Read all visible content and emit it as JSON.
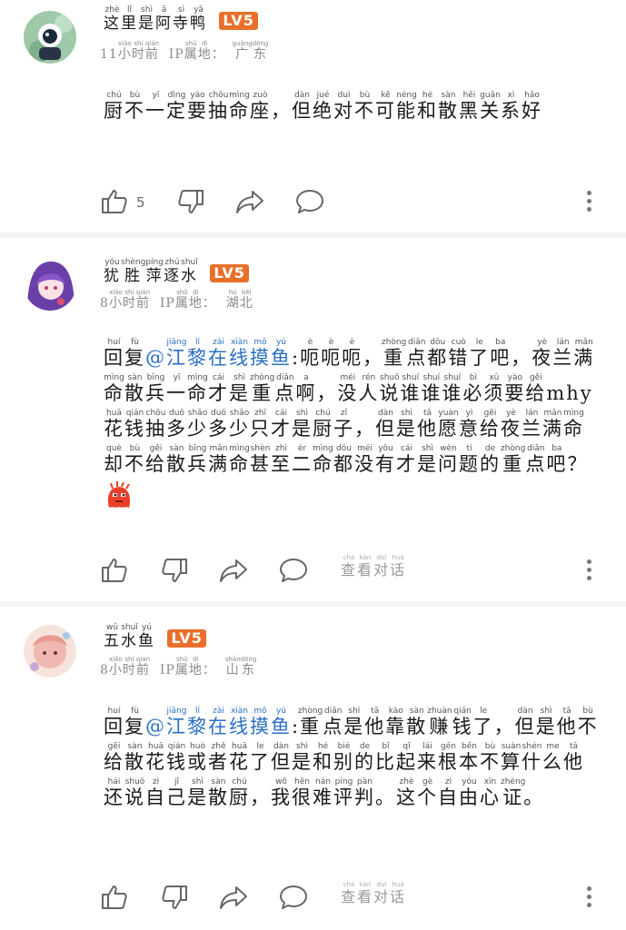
{
  "comments": [
    {
      "username": "这里是阿寺鸭",
      "username_pinyin": [
        "zhè",
        "lǐ",
        "shì",
        "ā",
        "sì",
        "yā"
      ],
      "level": "LV5",
      "time": "11小时前",
      "ip_label": "IP属地：",
      "location": "广东",
      "likes": "5",
      "body_text": "厨不一定要抽命座，但绝对不可能和散黑关系好"
    },
    {
      "username": "犹胜萍逐水",
      "level": "LV5",
      "time": "8小时前",
      "ip_label": "IP属地：",
      "location": "湖北",
      "reply_prefix": "回复",
      "mention": "@江黎在线摸鱼",
      "body_text": ":呃呃呃，重点都错了吧，夜兰满命散兵一命才是重点啊，没人说谁谁谁必须要给mhy花钱抽多少多少只才是厨子，但是他愿意给夜兰满命却不给散兵满命甚至二命都没有才是问题的重点吧？",
      "view_conversation": "查看对话"
    },
    {
      "username": "五水鱼",
      "level": "LV5",
      "time": "8小时前",
      "ip_label": "IP属地：",
      "location": "山东",
      "reply_prefix": "回复",
      "mention": "@江黎在线摸鱼",
      "body_text": ":重点是他靠散赚钱了，但是他不给散花钱或者花了但是和别的比起来根本不算什么他还说自己是散厨，我很难评判。这个自由心证。",
      "view_conversation": "查看对话"
    }
  ],
  "icons": [
    "like-icon",
    "dislike-icon",
    "share-icon",
    "comment-icon",
    "more-icon"
  ],
  "colors": {
    "level_badge": "#e8702a",
    "mention": "#2a6fc4",
    "separator": "#f2f2f2"
  }
}
